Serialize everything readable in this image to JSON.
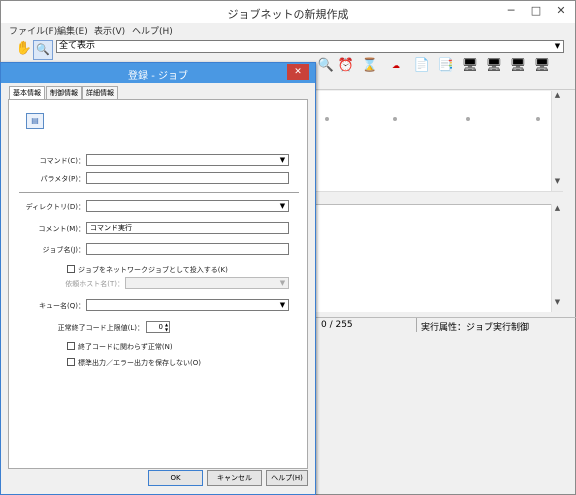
{
  "main_window": {
    "title": "ジョブネットの新規作成",
    "controls": {
      "minimize": "─",
      "maximize": "□",
      "close": "✕"
    },
    "menu": [
      "ファイル(F)",
      "編集(E)",
      "表示(V)",
      "ヘルプ(H)"
    ],
    "filter_combo_value": "全て表示",
    "status": {
      "count": "0 / 255",
      "attribute": "実行属性：ジョブ実行制御"
    }
  },
  "dialog": {
    "title": "登録 - ジョブ",
    "close": "✕",
    "tabs": [
      "基本情報",
      "制御情報",
      "詳細情報"
    ],
    "fields": {
      "command": {
        "label": "コマンド(C)：",
        "value": ""
      },
      "parameter": {
        "label": "パラメタ(P)：",
        "value": ""
      },
      "directory": {
        "label": "ディレクトリ(D)：",
        "value": ""
      },
      "comment": {
        "label": "コメント(M)：",
        "value": "コマンド実行"
      },
      "job_name": {
        "label": "ジョブ名(J)：",
        "value": ""
      },
      "network_job_checkbox": "ジョブをネットワークジョブとして投入する(K)",
      "request_host": {
        "label": "依頼ホスト名(T)：",
        "value": ""
      },
      "queue_name": {
        "label": "キュー名(Q)：",
        "value": ""
      },
      "exit_code_limit": {
        "label": "正常終了コード上限値(L)：",
        "value": "0"
      },
      "ignore_exit_checkbox": "終了コードに関わらず正常(N)",
      "no_save_output_checkbox": "標準出力／エラー出力を保存しない(O)"
    },
    "buttons": {
      "ok": "OK",
      "cancel": "キャンセル",
      "help": "ヘルプ(H)"
    }
  }
}
